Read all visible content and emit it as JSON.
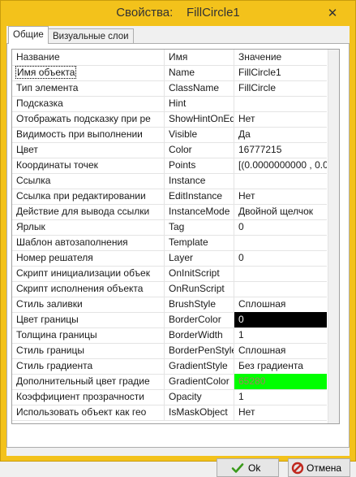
{
  "window": {
    "title_prefix": "Свойства:",
    "title_object": "FillCircle1",
    "close_glyph": "✕"
  },
  "tabs": [
    {
      "label": "Общие",
      "active": true
    },
    {
      "label": "Визуальные слои",
      "active": false
    }
  ],
  "table": {
    "headers": [
      "Название",
      "Имя",
      "Значение"
    ],
    "rows": [
      {
        "name": "Имя объекта",
        "id": "Name",
        "value": "FillCircle1",
        "selected": true
      },
      {
        "name": "Тип элемента",
        "id": "ClassName",
        "value": "FillCircle"
      },
      {
        "name": "Подсказка",
        "id": "Hint",
        "value": ""
      },
      {
        "name": "Отображать подсказку при ре",
        "id": "ShowHintOnEdit",
        "value": "Нет"
      },
      {
        "name": "Видимость при выполнении",
        "id": "Visible",
        "value": "Да"
      },
      {
        "name": "Цвет",
        "id": "Color",
        "value": "16777215"
      },
      {
        "name": "Координаты точек",
        "id": "Points",
        "value": "[(0.0000000000 , 0.00"
      },
      {
        "name": "Ссылка",
        "id": "Instance",
        "value": ""
      },
      {
        "name": "Ссылка при редактировании",
        "id": "EditInstance",
        "value": "Нет"
      },
      {
        "name": "Действие для вывода ссылки",
        "id": "InstanceMode",
        "value": "Двойной щелчок"
      },
      {
        "name": "Ярлык",
        "id": "Tag",
        "value": "0"
      },
      {
        "name": "Шаблон автозаполнения",
        "id": "Template",
        "value": ""
      },
      {
        "name": "Номер решателя",
        "id": "Layer",
        "value": "0"
      },
      {
        "name": "Скрипт инициализации объек",
        "id": "OnInitScript",
        "value": ""
      },
      {
        "name": "Скрипт исполнения объекта",
        "id": "OnRunScript",
        "value": ""
      },
      {
        "name": "Стиль заливки",
        "id": "BrushStyle",
        "value": "Сплошная"
      },
      {
        "name": "Цвет границы",
        "id": "BorderColor",
        "value": "0",
        "swatch": "#000000",
        "text_color": "#ffffff"
      },
      {
        "name": "Толщина границы",
        "id": "BorderWidth",
        "value": "1"
      },
      {
        "name": "Стиль границы",
        "id": "BorderPenStyle",
        "value": "Сплошная"
      },
      {
        "name": "Стиль градиента",
        "id": "GradientStyle",
        "value": "Без градиента"
      },
      {
        "name": "Дополнительный цвет градие",
        "id": "GradientColor",
        "value": "65280",
        "swatch": "#00ff00",
        "text_color": "#a08060"
      },
      {
        "name": "Коэффициент прозрачности",
        "id": "Opacity",
        "value": "1"
      },
      {
        "name": "Использовать объект как гео",
        "id": "IsMaskObject",
        "value": "Нет"
      }
    ]
  },
  "buttons": {
    "ok_label": "Ok",
    "cancel_label": "Отмена"
  },
  "colors": {
    "title_bar": "#f3c21b",
    "ok_check": "#3a9a1a",
    "cancel_ring": "#c0281e"
  },
  "icons": [
    "close-icon",
    "checkmark-icon",
    "cancel-circle-icon"
  ]
}
